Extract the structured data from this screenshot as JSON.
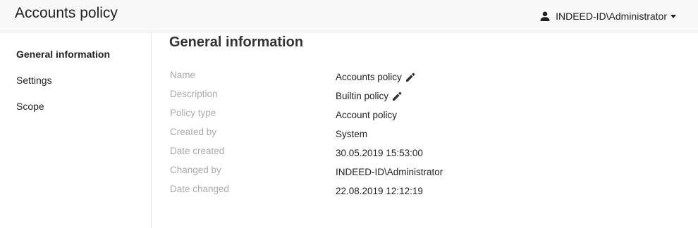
{
  "header": {
    "title": "Accounts policy",
    "user": "INDEED-ID\\Administrator"
  },
  "sidebar": {
    "items": [
      {
        "label": "General information",
        "active": true
      },
      {
        "label": "Settings",
        "active": false
      },
      {
        "label": "Scope",
        "active": false
      }
    ]
  },
  "main": {
    "section_title": "General information",
    "fields": [
      {
        "label": "Name",
        "value": "Accounts policy",
        "editable": true
      },
      {
        "label": "Description",
        "value": "Builtin policy",
        "editable": true
      },
      {
        "label": "Policy type",
        "value": "Account policy",
        "editable": false
      },
      {
        "label": "Created by",
        "value": "System",
        "editable": false
      },
      {
        "label": "Date created",
        "value": "30.05.2019 15:53:00",
        "editable": false
      },
      {
        "label": "Changed by",
        "value": "INDEED-ID\\Administrator",
        "editable": false
      },
      {
        "label": "Date changed",
        "value": "22.08.2019 12:12:19",
        "editable": false
      }
    ]
  },
  "icons": {
    "user": "user-icon",
    "edit": "pencil-icon",
    "dropdown": "caret-down-icon"
  },
  "colors": {
    "header_bg": "#f8f8f8",
    "label": "#aaaaaa",
    "text": "#222222"
  }
}
